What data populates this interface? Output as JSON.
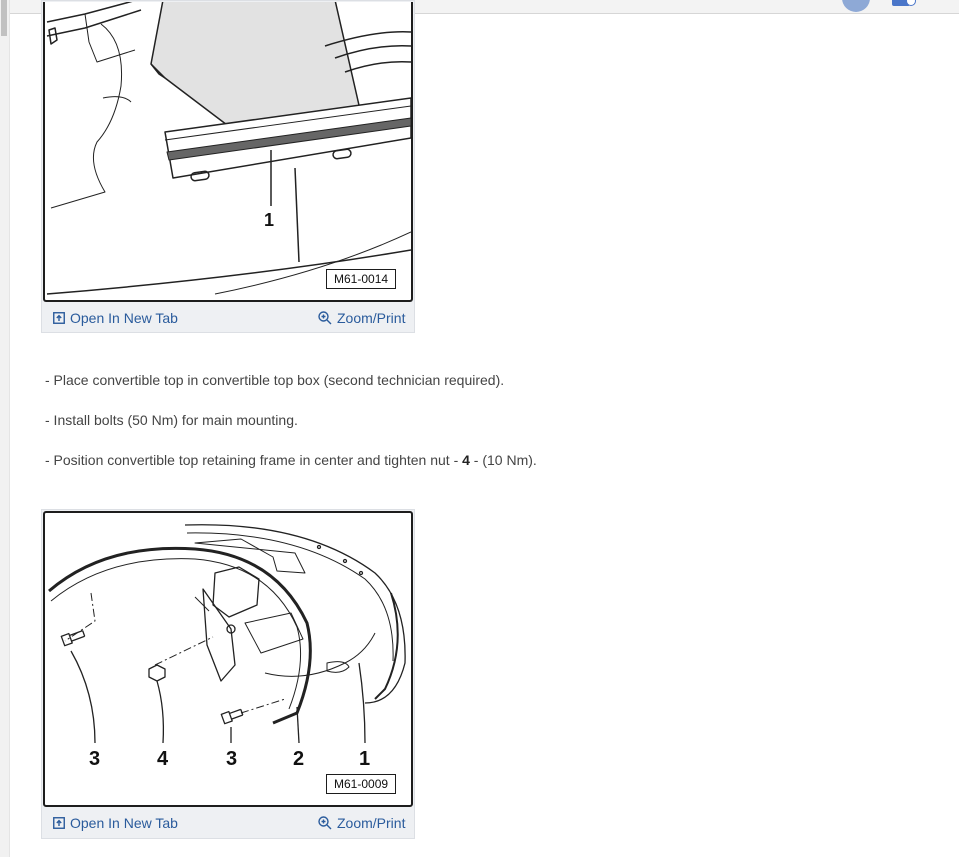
{
  "figures": [
    {
      "code": "M61-0014",
      "callouts": [
        "1"
      ],
      "open_label": "Open In New Tab",
      "zoom_label": "Zoom/Print"
    },
    {
      "code": "M61-0009",
      "callouts": [
        "3",
        "4",
        "3",
        "2",
        "1"
      ],
      "open_label": "Open In New Tab",
      "zoom_label": "Zoom/Print"
    }
  ],
  "steps": [
    {
      "text": "-  Place convertible top in convertible top box (second technician required)."
    },
    {
      "text_before": "-  Position convertible top retaining frame in center and tighten nut - ",
      "bold": "4",
      "text_after": " - (10 Nm)."
    }
  ],
  "step_install": "-  Install bolts (50 Nm) for main mounting.",
  "icons": {
    "open": "external-tab-icon",
    "zoom": "magnifier-plus-icon",
    "header_avatar": "user-avatar-icon",
    "header_alert": "notification-icon"
  },
  "colors": {
    "link": "#2a5b9c",
    "frame": "#1d1d1d",
    "bar": "#eef0f3"
  }
}
